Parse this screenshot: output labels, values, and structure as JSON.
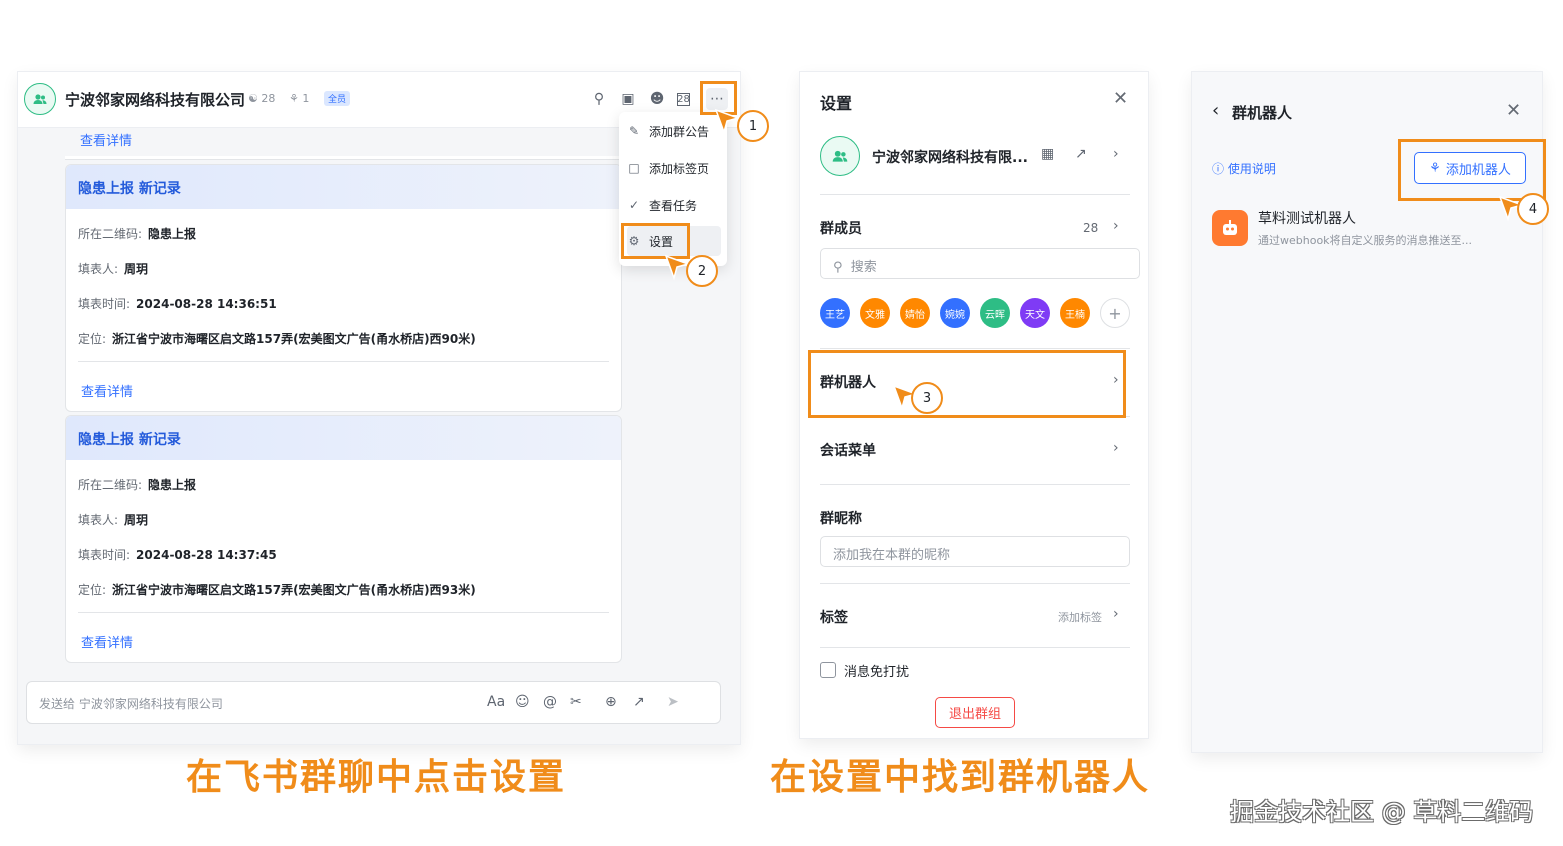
{
  "captions": {
    "left": "在飞书群聊中点击设置",
    "middle": "在设置中找到群机器人"
  },
  "watermark": "掘金技术社区 @ 草料二维码",
  "steps": [
    "1",
    "2",
    "3",
    "4"
  ],
  "chat": {
    "group_name": "宁波邻家网络科技有限公司",
    "member_count": "28",
    "bot_count": "1",
    "badge": "全员",
    "top_link": "查看详情",
    "cards": [
      {
        "title": "隐患上报 新记录",
        "qr_label": "所在二维码:",
        "qr_value": "隐患上报",
        "filler_label": "填表人:",
        "filler_value": "周玥",
        "time_label": "填表时间:",
        "time_value": "2024-08-28 14:36:51",
        "loc_label": "定位:",
        "loc_value": "浙江省宁波市海曙区启文路157弄(宏美图文广告(甬水桥店)西90米)",
        "link": "查看详情"
      },
      {
        "title": "隐患上报 新记录",
        "qr_label": "所在二维码:",
        "qr_value": "隐患上报",
        "filler_label": "填表人:",
        "filler_value": "周玥",
        "time_label": "填表时间:",
        "time_value": "2024-08-28 14:37:45",
        "loc_label": "定位:",
        "loc_value": "浙江省宁波市海曙区启文路157弄(宏美图文广告(甬水桥店)西93米)",
        "link": "查看详情"
      }
    ],
    "menu": [
      "添加群公告",
      "添加标签页",
      "查看任务",
      "设置"
    ],
    "composer_placeholder": "发送给 宁波邻家网络科技有限公司",
    "composer_font": "Aa"
  },
  "settings": {
    "title": "设置",
    "group_name": "宁波邻家网络科技有限...",
    "members_label": "群成员",
    "members_count": "28",
    "search_placeholder": "搜索",
    "members": [
      {
        "name": "王艺",
        "color": "#3370ff"
      },
      {
        "name": "文雅",
        "color": "#ff8800"
      },
      {
        "name": "婧怡",
        "color": "#ff8800"
      },
      {
        "name": "婉婉",
        "color": "#3370ff"
      },
      {
        "name": "云晖",
        "color": "#2ebd85"
      },
      {
        "name": "天文",
        "color": "#7f3bf5"
      },
      {
        "name": "王楠",
        "color": "#ff8800"
      }
    ],
    "bots_label": "群机器人",
    "menu_label": "会话菜单",
    "nickname_label": "群昵称",
    "nickname_placeholder": "添加我在本群的昵称",
    "tags_label": "标签",
    "tags_add": "添加标签",
    "mute_label": "消息免打扰",
    "exit_label": "退出群组"
  },
  "bots": {
    "title": "群机器人",
    "help": "使用说明",
    "add_button": "添加机器人",
    "bot_name": "草料测试机器人",
    "bot_desc": "通过webhook将自定义服务的消息推送至..."
  },
  "colors": {
    "accent_orange": "#f08c1a",
    "link_blue": "#3370ff",
    "danger_red": "#f54a45"
  }
}
